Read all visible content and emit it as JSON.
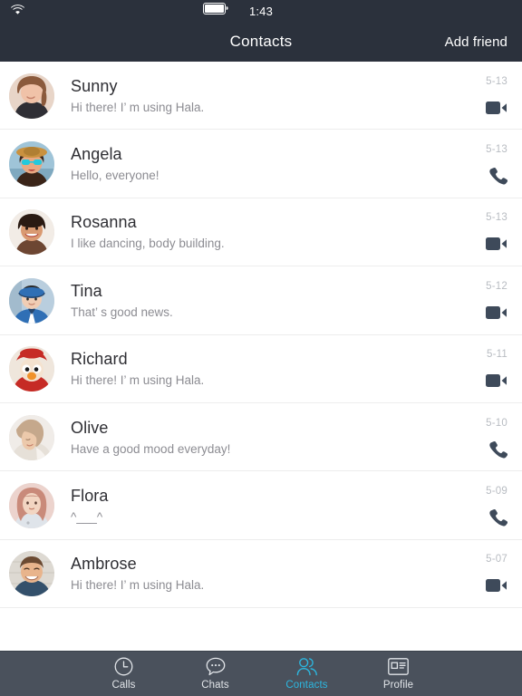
{
  "status_bar": {
    "time": "1:43",
    "wifi_icon": "wifi-icon",
    "battery_icon": "battery-full-icon"
  },
  "nav": {
    "title": "Contacts",
    "action_label": "Add friend"
  },
  "colors": {
    "header_bg": "#2b313c",
    "tabbar_bg": "#4a515c",
    "accent": "#2cb7e0",
    "name_text": "#2e2e33",
    "status_text": "#8c8c92",
    "date_text": "#b8bcc2",
    "action_icon": "#3e4a5a",
    "divider": "#ededed"
  },
  "contacts": [
    {
      "name": "Sunny",
      "status": "Hi there! I’ m using Hala.",
      "date": "5-13",
      "action": "video-call-icon",
      "avatar": {
        "skin": "#f0c2a8",
        "hair": "#8b5a3c",
        "bg": "#e8d5c8",
        "cloth": "#2f2f35"
      }
    },
    {
      "name": "Angela",
      "status": "Hello, everyone!",
      "date": "5-13",
      "action": "phone-call-icon",
      "avatar": {
        "skin": "#e8a882",
        "hair": "#3a2418",
        "bg": "#9fc4d8",
        "cloth": "#c9913f"
      }
    },
    {
      "name": "Rosanna",
      "status": "I like dancing, body building.",
      "date": "5-13",
      "action": "video-call-icon",
      "avatar": {
        "skin": "#d99a72",
        "hair": "#2a1a12",
        "bg": "#f2ece6",
        "cloth": "#6d4632"
      }
    },
    {
      "name": "Tina",
      "status": "That’ s good news.",
      "date": "5-12",
      "action": "video-call-icon",
      "avatar": {
        "skin": "#f0cdb4",
        "hair": "#2b2b2b",
        "bg": "#b9cede",
        "cloth": "#2f6fb5"
      }
    },
    {
      "name": "Richard",
      "status": "Hi there! I’ m using Hala.",
      "date": "5-11",
      "action": "video-call-icon",
      "avatar": {
        "skin": "#f4e2cf",
        "hair": "#c62b25",
        "bg": "#efe6dc",
        "cloth": "#c62b25"
      }
    },
    {
      "name": "Olive",
      "status": "Have a good mood everyday!",
      "date": "5-10",
      "action": "phone-call-icon",
      "avatar": {
        "skin": "#ecc9ab",
        "hair": "#c5a88c",
        "bg": "#f0ece8",
        "cloth": "#e6e0d8"
      }
    },
    {
      "name": "Flora",
      "status": "^___^",
      "date": "5-09",
      "action": "phone-call-icon",
      "avatar": {
        "skin": "#f2d5c2",
        "hair": "#c98a7a",
        "bg": "#ecd3cd",
        "cloth": "#dfe4ea"
      }
    },
    {
      "name": "Ambrose",
      "status": "Hi there! I’ m using Hala.",
      "date": "5-07",
      "action": "video-call-icon",
      "avatar": {
        "skin": "#e8b48c",
        "hair": "#6b4a32",
        "bg": "#ddd9d2",
        "cloth": "#33506b"
      }
    }
  ],
  "tabs": [
    {
      "label": "Calls",
      "icon": "clock-icon",
      "active": false
    },
    {
      "label": "Chats",
      "icon": "chat-bubble-icon",
      "active": false
    },
    {
      "label": "Contacts",
      "icon": "people-icon",
      "active": true
    },
    {
      "label": "Profile",
      "icon": "contact-card-icon",
      "active": false
    }
  ]
}
